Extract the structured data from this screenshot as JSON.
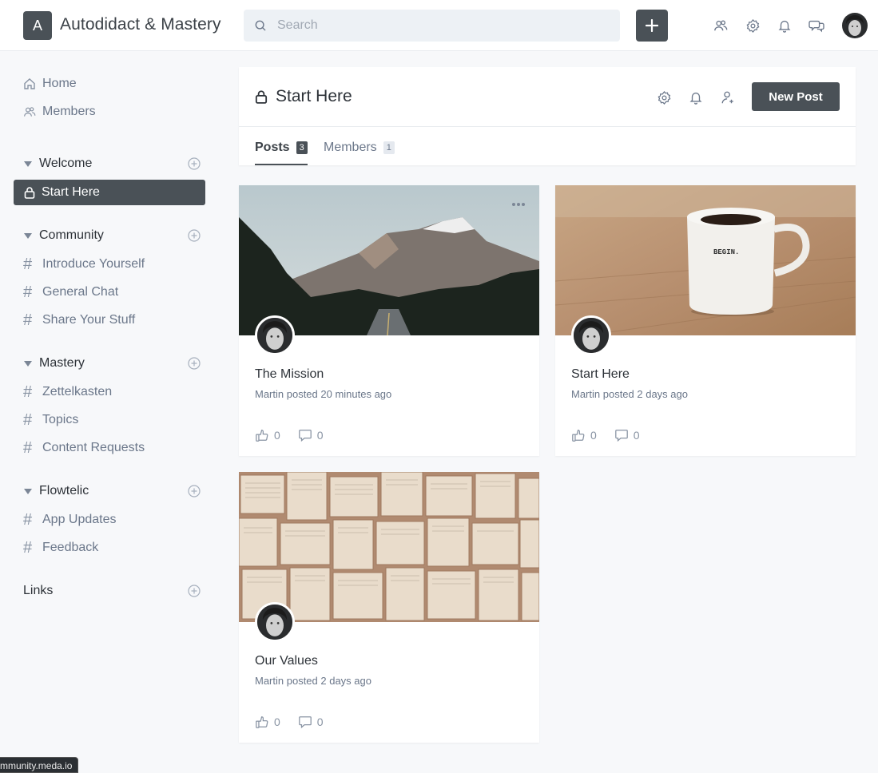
{
  "app": {
    "logo_letter": "A",
    "title": "Autodidact & Mastery"
  },
  "search": {
    "placeholder": "Search",
    "value": ""
  },
  "topbar": {
    "icons": [
      "members-icon",
      "settings-icon",
      "notifications-icon",
      "messages-icon"
    ],
    "create_label": "+"
  },
  "sidebar": {
    "nav": [
      {
        "label": "Home",
        "icon": "home-icon"
      },
      {
        "label": "Members",
        "icon": "members-icon"
      }
    ],
    "sections": [
      {
        "title": "Welcome",
        "collapsible": true,
        "channels": [
          {
            "label": "Start Here",
            "icon": "lock-icon",
            "active": true
          }
        ]
      },
      {
        "title": "Community",
        "collapsible": true,
        "channels": [
          {
            "label": "Introduce Yourself"
          },
          {
            "label": "General Chat"
          },
          {
            "label": "Share Your Stuff"
          }
        ]
      },
      {
        "title": "Mastery",
        "collapsible": true,
        "channels": [
          {
            "label": "Zettelkasten"
          },
          {
            "label": "Topics"
          },
          {
            "label": "Content Requests"
          }
        ]
      },
      {
        "title": "Flowtelic",
        "collapsible": true,
        "channels": [
          {
            "label": "App Updates"
          },
          {
            "label": "Feedback"
          }
        ]
      },
      {
        "title": "Links",
        "collapsible": false,
        "channels": []
      }
    ]
  },
  "channel": {
    "title": "Start Here",
    "new_post_label": "New Post",
    "tabs": [
      {
        "label": "Posts",
        "count": "3",
        "active": true
      },
      {
        "label": "Members",
        "count": "1",
        "active": false
      }
    ]
  },
  "posts": [
    {
      "title": "The Mission",
      "meta": "Martin posted 20 minutes ago",
      "likes": "0",
      "comments": "0",
      "image": "mountain-road"
    },
    {
      "title": "Start Here",
      "meta": "Martin posted 2 days ago",
      "likes": "0",
      "comments": "0",
      "image": "begin-mug"
    },
    {
      "title": "Our Values",
      "meta": "Martin posted 2 days ago",
      "likes": "0",
      "comments": "0",
      "image": "open-books"
    }
  ],
  "status_url": "mmunity.meda.io",
  "colors": {
    "dark": "#4a5157",
    "muted": "#6b778a",
    "bg": "#f7f8fa"
  }
}
